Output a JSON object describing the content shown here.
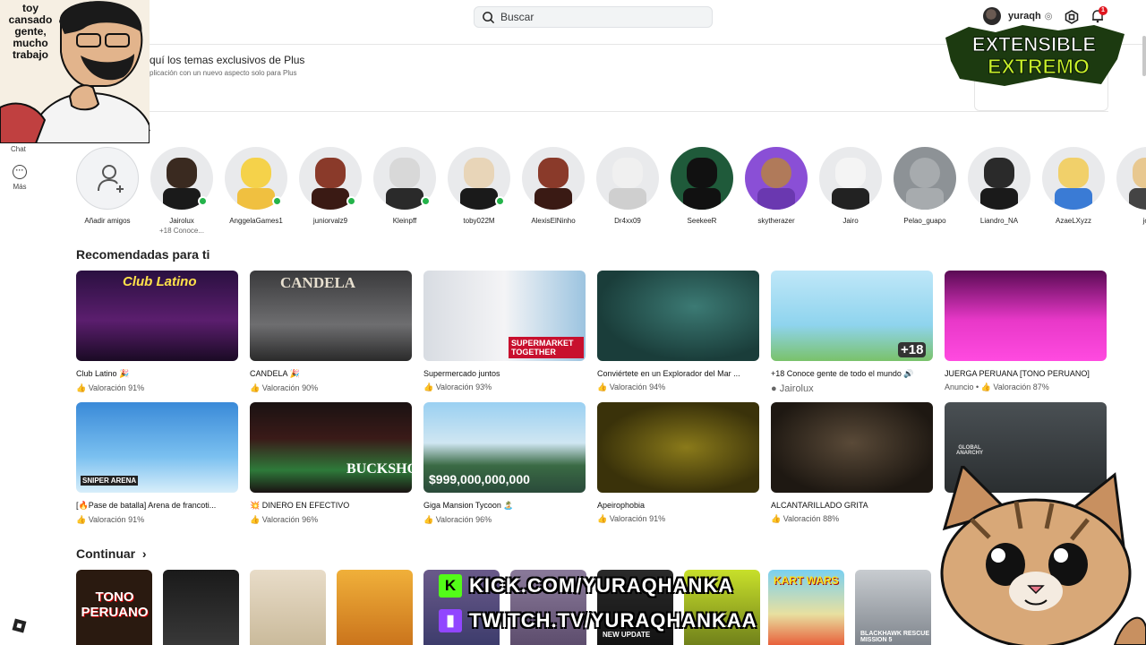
{
  "search": {
    "placeholder": "Buscar"
  },
  "user": {
    "name": "yuraqh",
    "notifications": "1"
  },
  "meme": {
    "text": "toy cansado gente, mucho trabajo"
  },
  "nav": {
    "chat": "Chat",
    "more": "Más"
  },
  "plus_banner": {
    "title": "quí los temas exclusivos de Plus",
    "subtitle": "plicación con un nuevo aspecto solo para Plus"
  },
  "overlay": {
    "extensible_line1": "EXTENSIBLE",
    "extensible_line2": "EXTREMO"
  },
  "friends": [
    {
      "name": "Añadir amigos",
      "sub": ""
    },
    {
      "name": "Jairolux",
      "sub": "+18 Conoce..."
    },
    {
      "name": "AnggelaGames1",
      "sub": ""
    },
    {
      "name": "juniorvalz9",
      "sub": ""
    },
    {
      "name": "Kleinpff",
      "sub": ""
    },
    {
      "name": "toby022M",
      "sub": ""
    },
    {
      "name": "AlexisElNinho",
      "sub": ""
    },
    {
      "name": "Dr4xx09",
      "sub": ""
    },
    {
      "name": "SeekeeR",
      "sub": ""
    },
    {
      "name": "skytherazer",
      "sub": ""
    },
    {
      "name": "Jairo",
      "sub": ""
    },
    {
      "name": "Pelao_guapo",
      "sub": ""
    },
    {
      "name": "Liandro_NA",
      "sub": ""
    },
    {
      "name": "AzaeLXyzz",
      "sub": ""
    },
    {
      "name": "joa",
      "sub": ""
    }
  ],
  "recommended": {
    "title": "Recomendadas para ti",
    "row1": [
      {
        "title": "Club Latino 🎉",
        "meta": "👍 Valoración 91%",
        "thumb_text": "Club Latino"
      },
      {
        "title": "CANDELA 🎉",
        "meta": "👍 Valoración 90%",
        "thumb_text": "CANDELA"
      },
      {
        "title": "Supermercado juntos",
        "meta": "👍 Valoración 93%",
        "thumb_text": "SUPERMARKET TOGETHER"
      },
      {
        "title": "Conviértete en un Explorador del Mar ...",
        "meta": "👍 Valoración 94%",
        "thumb_text": ""
      },
      {
        "title": "+18 Conoce gente de todo el mundo 🔊",
        "meta": "Jairolux",
        "thumb_text": "+18"
      },
      {
        "title": "JUERGA PERUANA [TONO PERUANO]",
        "meta": "Anuncio • 👍 Valoración 87%",
        "thumb_text": ""
      }
    ],
    "row2": [
      {
        "title": "[🔥Pase de batalla] Arena de francoti...",
        "meta": "👍 Valoración 91%",
        "thumb_text": "SNIPER ARENA"
      },
      {
        "title": "💥 DINERO EN EFECTIVO",
        "meta": "👍 Valoración 96%",
        "thumb_text": "BUCKSHOT"
      },
      {
        "title": "Giga Mansion Tycoon 🏝️",
        "meta": "👍 Valoración 96%",
        "thumb_text": "$999,000,000,000"
      },
      {
        "title": "Apeirophobia",
        "meta": "👍 Valoración 91%",
        "thumb_text": ""
      },
      {
        "title": "ALCANTARILLADO GRITA",
        "meta": "👍 Valoración 88%",
        "thumb_text": ""
      },
      {
        "title": "",
        "meta": "",
        "thumb_text": "GLOBAL ANARCHY"
      }
    ]
  },
  "continue": {
    "title": "Continuar",
    "thumb_texts": [
      "TONO PERUANO",
      "",
      "",
      "",
      "",
      "",
      "NEW UPDATE",
      "",
      "KART WARS",
      "BLACKHAWK RESCUE MISSION 5"
    ]
  },
  "stream": {
    "kick": "KICK.COM/YURAQHANKA",
    "twitch": "TWITCH.TV/YURAQHANKAA"
  },
  "colors": {
    "online": "#24b34a",
    "badge": "#e0161f",
    "kick": "#53fc18",
    "twitch": "#9146ff"
  }
}
